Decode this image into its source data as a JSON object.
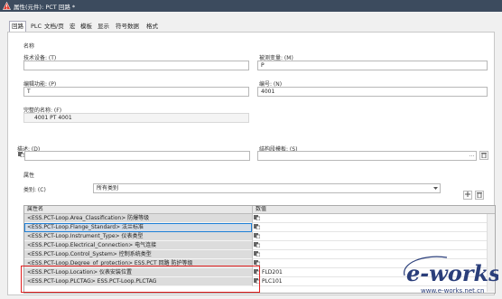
{
  "titlebar": {
    "title": "属性(元件): PCT 回路 *"
  },
  "tabs": [
    "回路",
    "PLC",
    "文档/页",
    "宏",
    "模板",
    "显示",
    "符号数据",
    "格式"
  ],
  "fields": {
    "section_name": "名称",
    "tech_equipment_label": "技术设备: (T)",
    "tech_equipment_value": "",
    "measured_variable_label": "被测变量: (M)",
    "measured_variable_value": "P",
    "processing_function_label": "编辑功能: (P)",
    "processing_function_value": "T",
    "number_label": "编号: (N)",
    "number_value": "4001",
    "full_name_label": "完整的名称: (F)",
    "full_name_value": "4001 PT 4001",
    "description_label": "描述: (D)",
    "description_value": "",
    "structure_template_label": "结构段模板: (S)",
    "structure_template_value": "",
    "ellipsis": "...",
    "properties_section": "属性",
    "category_label": "类别: (C)",
    "category_value": "所有类别"
  },
  "grid": {
    "headers": [
      "属性名",
      "数值"
    ],
    "rows": [
      {
        "name": "<ESS.PCT-Loop.Area_Classification> 防爆等级",
        "value": ""
      },
      {
        "name": "<ESS.PCT-Loop.Flange_Standard> 法兰标准",
        "value": ""
      },
      {
        "name": "<ESS.PCT-Loop.Instrument_Type> 仪表类型",
        "value": ""
      },
      {
        "name": "<ESS.PCT-Loop.Electrical_Connection> 电气连接",
        "value": ""
      },
      {
        "name": "<ESS.PCT-Loop.Control_System> 控制系统类型",
        "value": ""
      },
      {
        "name": "<ESS.PCT-Loop.Degree_of_protection> ESS.PCT 回路 防护等级",
        "value": ""
      },
      {
        "name": "<ESS.PCT-Loop.Location> 仪表安装位置",
        "value": "FLD201"
      },
      {
        "name": "<ESS.PCT-Loop.PLCTAG> ESS.PCT-Loop.PLCTAG",
        "value": "PLC101"
      }
    ]
  },
  "watermark": {
    "text": "e-works",
    "sub": "www.e-works.net.cn"
  },
  "colors": {
    "titlebar": "#3c4b5e",
    "highlight": "#e02020",
    "selection": "#1e7fd6",
    "watermark": "#2a3e7a"
  }
}
